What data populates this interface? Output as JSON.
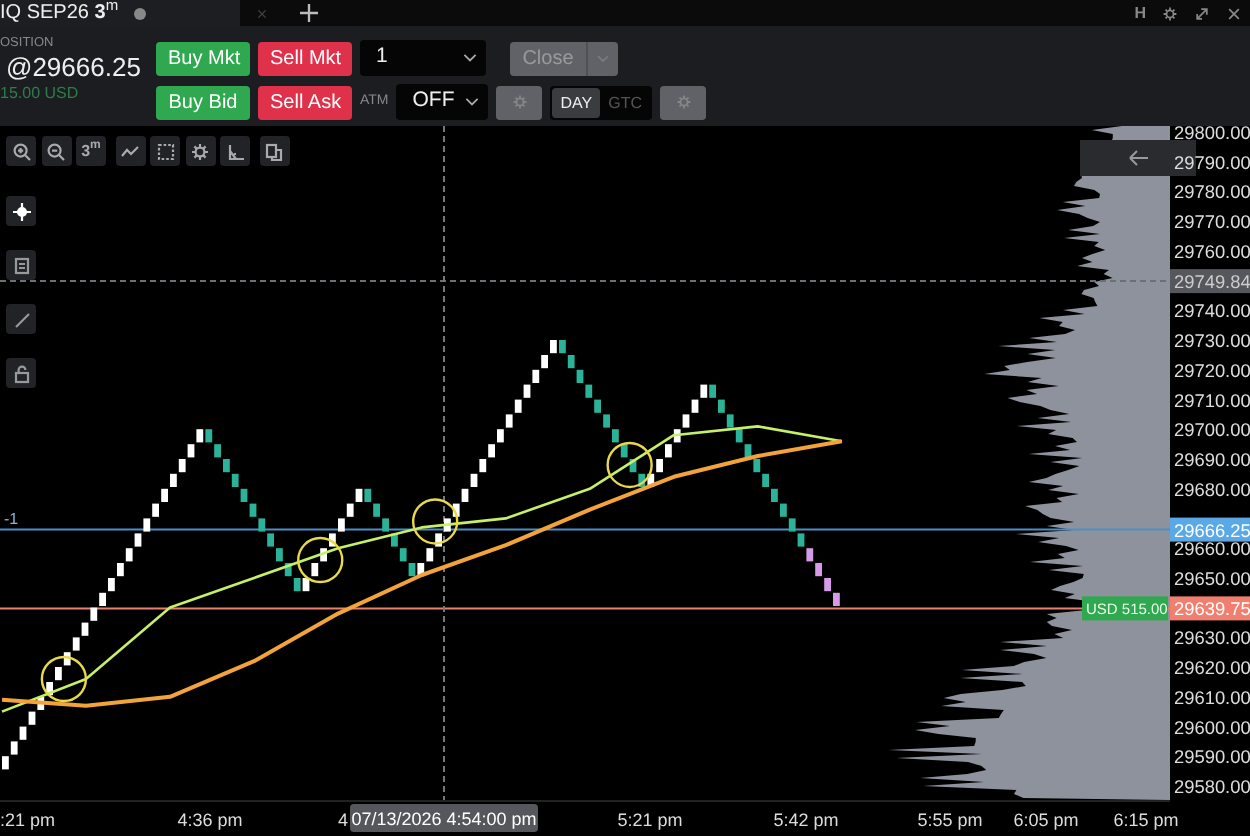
{
  "tab": {
    "title": "IQ SEP26 **3**$^{m}$",
    "selected": true
  },
  "window_controls": [
    {
      "kind": "text",
      "label": "H"
    },
    {
      "kind": "gear"
    },
    {
      "kind": "expand"
    },
    {
      "kind": "close"
    }
  ],
  "position": {
    "label": "OSITION",
    "price": "@29666.25",
    "pnl": "15.00 USD"
  },
  "order_panel": {
    "row_1": [
      {
        "kind": "buy",
        "label": "Buy Mkt"
      },
      {
        "kind": "sell",
        "label": "Sell Mkt"
      },
      {
        "kind": "select",
        "value": "1"
      },
      {
        "kind": "split",
        "label": "Close",
        "disabled": true
      }
    ],
    "row_2": [
      {
        "kind": "buy",
        "label": "Buy Bid"
      },
      {
        "kind": "sell",
        "label": "Sell Ask"
      },
      {
        "kind": "label",
        "label": "ATM"
      },
      {
        "kind": "select",
        "value": "OFF"
      },
      {
        "kind": "gear",
        "disabled": true
      },
      {
        "kind": "toggle",
        "options": [
          {
            "label": "DAY",
            "selected": true
          },
          {
            "label": "GTC",
            "selected": false
          }
        ]
      },
      {
        "kind": "gear",
        "disabled": true
      }
    ]
  },
  "top_tools": [
    {
      "kind": "zoom_in"
    },
    {
      "kind": "zoom_out"
    },
    {
      "kind": "interval",
      "label": "3$^{m}$"
    },
    {
      "kind": "line"
    },
    {
      "kind": "marquee"
    },
    {
      "kind": "gear"
    },
    {
      "kind": "angle"
    },
    {
      "kind": "copy"
    }
  ],
  "side_tools": [
    {
      "kind": "crosshair",
      "selected": true
    },
    {
      "kind": "note",
      "selected": false
    },
    {
      "kind": "pen",
      "selected": false
    },
    {
      "kind": "lock",
      "selected": false
    }
  ],
  "chart": {
    "price_labels": [
      "29800.00",
      "29790.00",
      "29780.00",
      "29770.00",
      "29760.00",
      "29740.00",
      "29730.00",
      "29720.00",
      "29710.00",
      "29700.00",
      "29690.00",
      "29680.00",
      "29660.00",
      "29650.00",
      "29630.00",
      "29620.00",
      "29610.00",
      "29600.00",
      "29590.00",
      "29580.00"
    ],
    "price_tags": [
      {
        "kind": "last",
        "label": "29749.84"
      },
      {
        "kind": "position",
        "label": "29666.25",
        "side_label": "-1"
      },
      {
        "kind": "target",
        "label": "29639.75",
        "tag": "USD 515.00"
      }
    ],
    "time_labels": [
      ":21 pm",
      "4:36 pm",
      "4",
      "5:21 pm",
      "5:42 pm",
      "5:55 pm",
      "6:05 pm",
      "6:15 pm"
    ],
    "crosshair_time": "07/13/2026 4:54:00 pm"
  }
}
